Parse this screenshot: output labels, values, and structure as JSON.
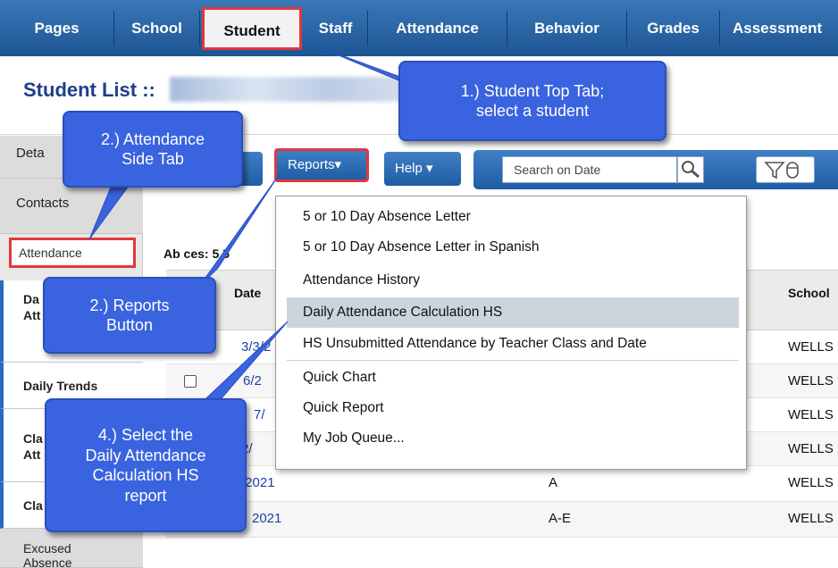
{
  "top_tabs": [
    "Pages",
    "School",
    "Student",
    "Staff",
    "Attendance",
    "Behavior",
    "Grades",
    "Assessment"
  ],
  "active_top_tab": "Student",
  "page_title": "Student List ::",
  "side_tabs": {
    "details": "Deta",
    "contacts": "Contacts",
    "attendance": "Attendance",
    "daily_attendance": "Da\nAtt",
    "daily_attendance_sub": "D",
    "daily_trends": "Daily Trends",
    "class_attendance": "Cla\nAtt",
    "class": "Cla",
    "excused_absence": "Excused\nAbsence"
  },
  "toolbar": {
    "reports_label": "Reports",
    "help_label": "Help",
    "search_placeholder": "Search on Date"
  },
  "absences_label": "Ab    ces: 5.5",
  "table": {
    "headers": {
      "date": "Date",
      "school": "School"
    },
    "rows": [
      {
        "date": "3/3/2",
        "code": "",
        "school": "WELLS",
        "checkbox": false
      },
      {
        "date": "6/2",
        "code": "",
        "school": "WELLS",
        "checkbox": true
      },
      {
        "date": "7/",
        "code": "",
        "school": "WELLS",
        "checkbox": false
      },
      {
        "date": "2/",
        "code": "",
        "school": "WELLS",
        "checkbox": false
      },
      {
        "date": "/2021",
        "code": "A",
        "school": "WELLS",
        "checkbox": false
      },
      {
        "date": "2021",
        "code": "A-E",
        "school": "WELLS",
        "checkbox": false
      }
    ]
  },
  "reports_menu": {
    "items": [
      "5 or 10 Day Absence Letter",
      "5 or 10 Day Absence Letter in Spanish",
      "Attendance History",
      "Daily Attendance Calculation HS",
      "HS Unsubmitted Attendance by Teacher Class and Date",
      "Quick Chart",
      "Quick Report",
      "My Job Queue..."
    ],
    "highlighted": "Daily Attendance Calculation HS"
  },
  "callouts": {
    "step1": "1.) Student Top Tab;\nselect a student",
    "step2a": "2.) Attendance\nSide Tab",
    "step2b": "2.) Reports\nButton",
    "step4": "4.) Select the\nDaily Attendance\nCalculation HS\nreport"
  },
  "colors": {
    "tab_bar": "#2a64a6",
    "highlight_border": "#e0383e",
    "callout_fill": "#3a63df",
    "link": "#1f3ea8",
    "menu_highlight": "#ccd4dd"
  }
}
